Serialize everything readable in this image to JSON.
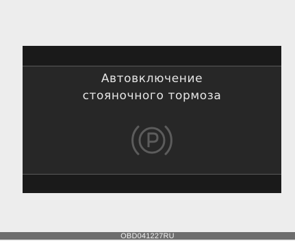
{
  "display": {
    "message_line1": "Автовключение",
    "message_line2": "стояночного тормоза",
    "icon": "parking-brake-icon",
    "icon_color": "#5c5c5c",
    "screen_color": "#272727"
  },
  "footer": {
    "code": "OBD041227RU"
  }
}
